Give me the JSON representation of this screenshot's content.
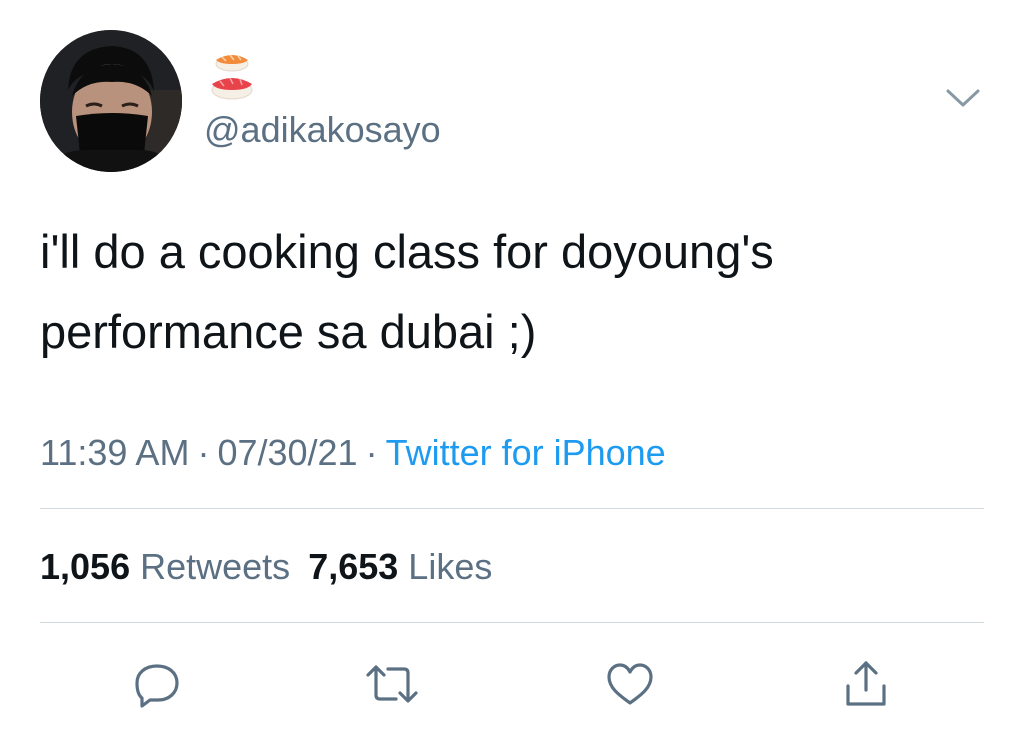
{
  "tweet": {
    "handle": "@adikakosayo",
    "display_name_icon": "sushi-emoji",
    "text_line1": "i'll do a cooking class for doyoung's",
    "text_line2": "performance sa dubai ;)",
    "time": "11:39 AM",
    "date": "07/30/21",
    "source": "Twitter for iPhone",
    "separator": "·"
  },
  "stats": {
    "retweets_count": "1,056",
    "retweets_label": "Retweets",
    "likes_count": "7,653",
    "likes_label": "Likes"
  },
  "actions": [
    "reply-icon",
    "retweet-icon",
    "like-icon",
    "share-icon"
  ],
  "colors": {
    "text": "#0f1419",
    "secondary": "#5b7083",
    "link": "#1d9bf0",
    "divider": "#cfd9de"
  }
}
